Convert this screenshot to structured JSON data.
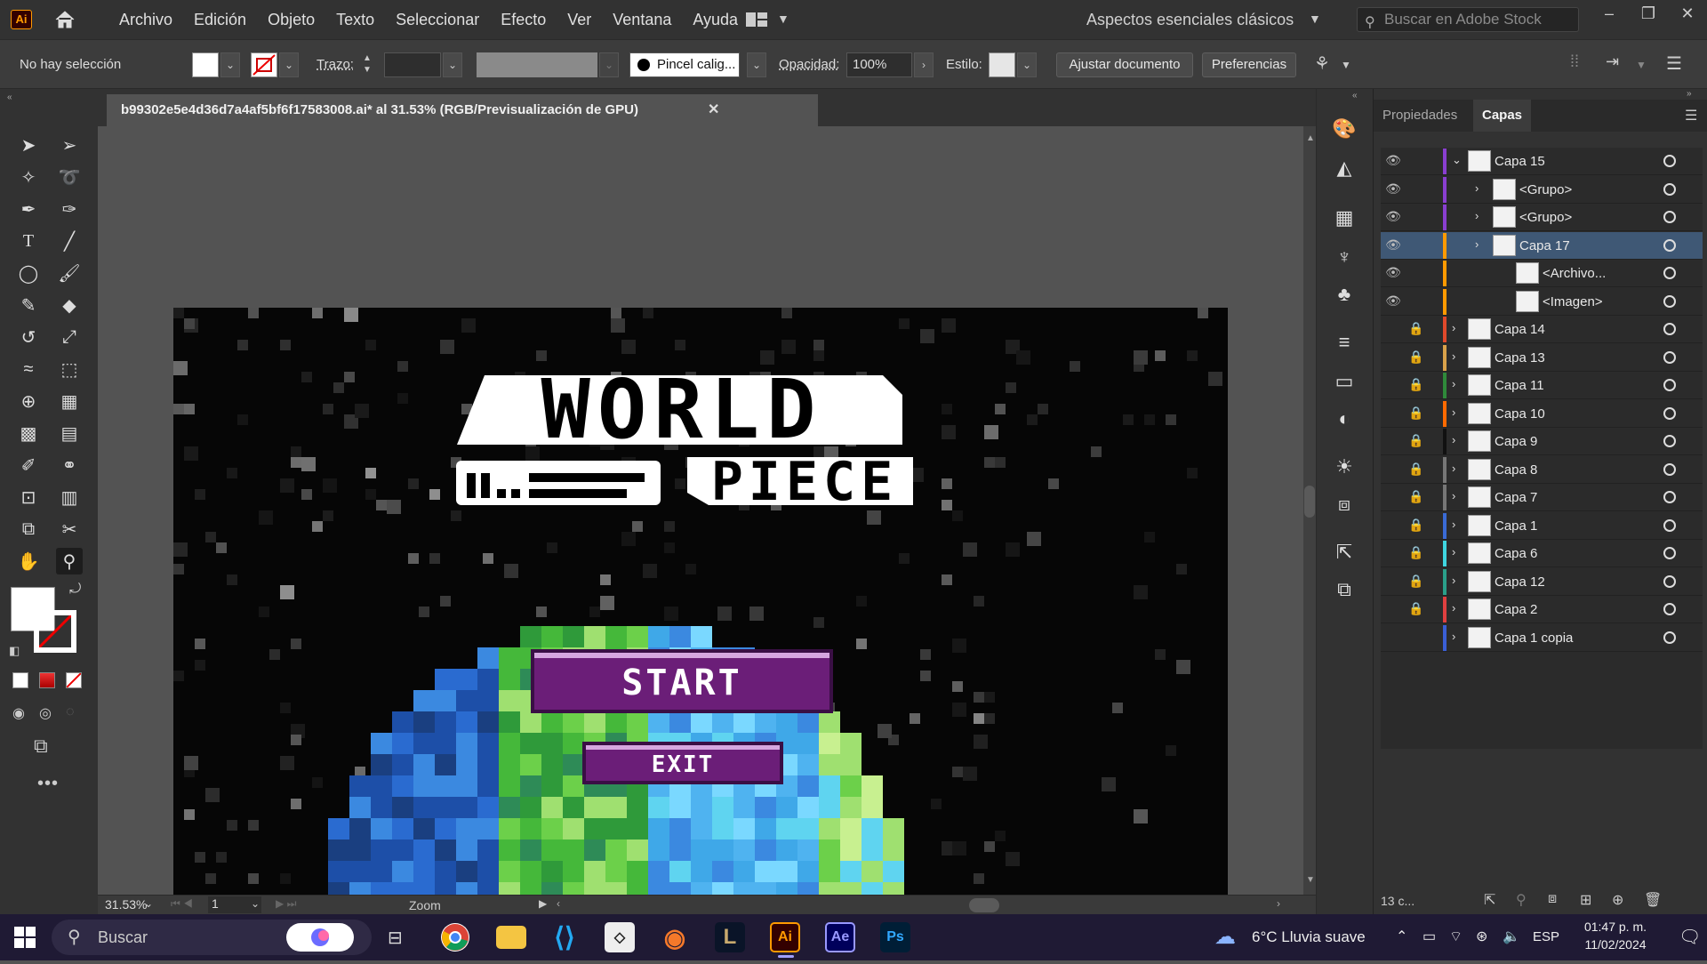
{
  "menubar": {
    "app_logo": "Ai",
    "menus": [
      "Archivo",
      "Edición",
      "Objeto",
      "Texto",
      "Seleccionar",
      "Efecto",
      "Ver",
      "Ventana",
      "Ayuda"
    ],
    "workspace": "Aspectos esenciales clásicos",
    "stock_placeholder": "Buscar en Adobe Stock"
  },
  "control_bar": {
    "selection": "No hay selección",
    "stroke_label": "Trazo:",
    "brush": "Pincel calig...",
    "opacity_label": "Opacidad:",
    "opacity_value": "100%",
    "style_label": "Estilo:",
    "adjust_doc": "Ajustar documento",
    "preferences": "Preferencias"
  },
  "document": {
    "tab_title": "b99302e5e4d36d7a4af5bf6f17583008.ai* al 31.53% (RGB/Previsualización de GPU)",
    "close": "✕"
  },
  "artwork": {
    "title_line1": "WORLD",
    "title_line2": "PIECE",
    "start_label": "START",
    "exit_label": "EXIT",
    "colors": {
      "button_fill": "#6b1e78",
      "button_border": "#d6a7e0",
      "bg": "#060606"
    }
  },
  "status": {
    "zoom": "31.53%",
    "artboard": "1",
    "tool": "Zoom"
  },
  "panel": {
    "tabs": [
      "Propiedades",
      "Capas"
    ],
    "active_tab": "Capas",
    "layer_count": "13 c...",
    "layers": [
      {
        "name": "Capa 15",
        "visible": true,
        "locked": false,
        "expanded": true,
        "indent": 0,
        "color": "#8a3fd1"
      },
      {
        "name": "<Grupo>",
        "visible": true,
        "locked": false,
        "expanded": false,
        "indent": 1,
        "color": "#8a3fd1"
      },
      {
        "name": "<Grupo>",
        "visible": true,
        "locked": false,
        "expanded": false,
        "indent": 1,
        "color": "#8a3fd1"
      },
      {
        "name": "Capa 17",
        "visible": true,
        "locked": false,
        "expanded": false,
        "indent": 1,
        "color": "#ff9a00",
        "selected": true
      },
      {
        "name": "<Archivo...",
        "visible": true,
        "locked": false,
        "expanded": false,
        "indent": 2,
        "color": "#ff9a00"
      },
      {
        "name": "<Imagen>",
        "visible": true,
        "locked": false,
        "expanded": false,
        "indent": 2,
        "color": "#ff9a00"
      },
      {
        "name": "Capa 14",
        "visible": false,
        "locked": true,
        "expanded": false,
        "indent": 0,
        "color": "#e0492b"
      },
      {
        "name": "Capa 13",
        "visible": false,
        "locked": true,
        "expanded": false,
        "indent": 0,
        "color": "#d9a24a"
      },
      {
        "name": "Capa 11",
        "visible": false,
        "locked": true,
        "expanded": false,
        "indent": 0,
        "color": "#2f8a3a"
      },
      {
        "name": "Capa 10",
        "visible": false,
        "locked": true,
        "expanded": false,
        "indent": 0,
        "color": "#ff6a00"
      },
      {
        "name": "Capa 9",
        "visible": false,
        "locked": true,
        "expanded": false,
        "indent": 0,
        "color": "#111111"
      },
      {
        "name": "Capa 8",
        "visible": false,
        "locked": true,
        "expanded": false,
        "indent": 0,
        "color": "#777777"
      },
      {
        "name": "Capa 7",
        "visible": false,
        "locked": true,
        "expanded": false,
        "indent": 0,
        "color": "#777777"
      },
      {
        "name": "Capa 1",
        "visible": false,
        "locked": true,
        "expanded": false,
        "indent": 0,
        "color": "#3a6bd6"
      },
      {
        "name": "Capa 6",
        "visible": false,
        "locked": true,
        "expanded": false,
        "indent": 0,
        "color": "#3fd6e0"
      },
      {
        "name": "Capa 12",
        "visible": false,
        "locked": true,
        "expanded": false,
        "indent": 0,
        "color": "#2aa08a"
      },
      {
        "name": "Capa 2",
        "visible": false,
        "locked": true,
        "expanded": false,
        "indent": 0,
        "color": "#e04040"
      },
      {
        "name": "Capa 1 copia",
        "visible": false,
        "locked": false,
        "expanded": false,
        "indent": 0,
        "color": "#3a5fd6"
      }
    ]
  },
  "taskbar": {
    "search": "Buscar",
    "weather": "6°C  Lluvia suave",
    "lang": "ESP",
    "time": "01:47 p. m.",
    "date": "11/02/2024",
    "apps": [
      "Chrome",
      "Explorador",
      "VS Code",
      "Unity",
      "Blender",
      "League",
      "Ai",
      "Ae",
      "Ps"
    ]
  }
}
